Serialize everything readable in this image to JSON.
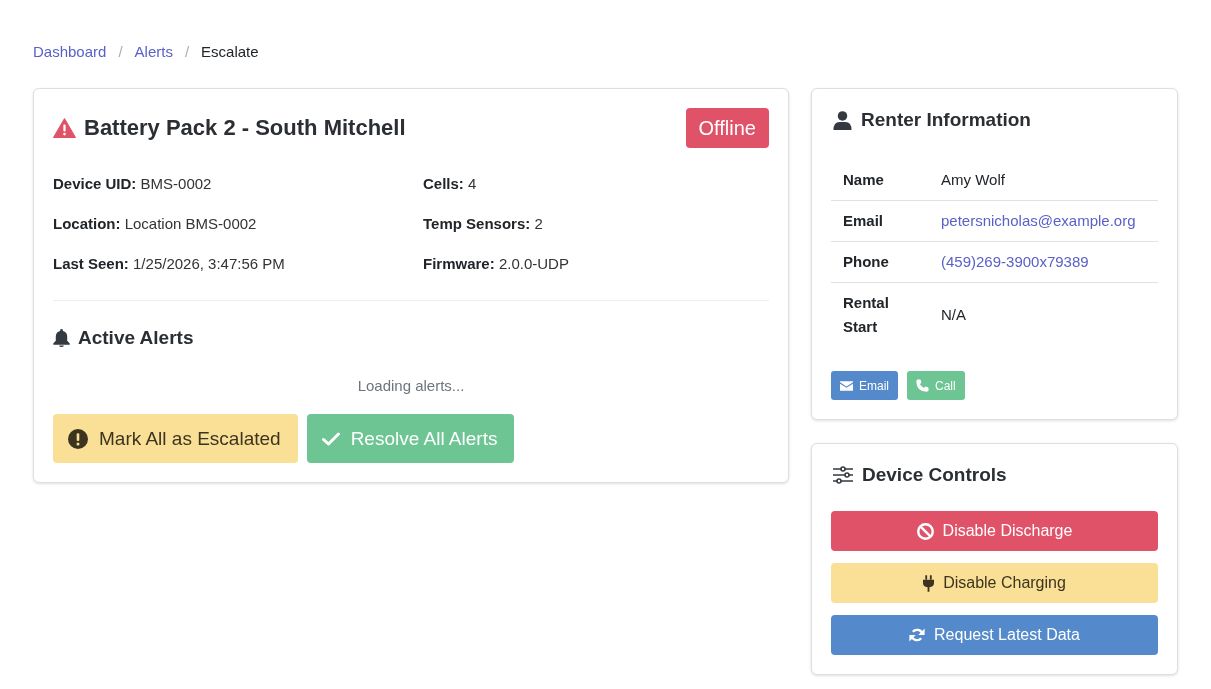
{
  "breadcrumb": {
    "separator": "/",
    "items": [
      {
        "label": "Dashboard",
        "kind": "link"
      },
      {
        "label": "Alerts",
        "kind": "link"
      },
      {
        "label": "Escalate",
        "kind": "current"
      }
    ]
  },
  "device_card": {
    "title": "Battery Pack 2 - South Mitchell",
    "status": "Offline",
    "field_columns": [
      {
        "fields": [
          {
            "label": "Device UID:",
            "value": "BMS-0002"
          },
          {
            "label": "Location:",
            "value": "Location BMS-0002"
          },
          {
            "label": "Last Seen:",
            "value": "1/25/2026, 3:47:56 PM"
          }
        ]
      },
      {
        "fields": [
          {
            "label": "Cells:",
            "value": "4"
          },
          {
            "label": "Temp Sensors:",
            "value": "2"
          },
          {
            "label": "Firmware:",
            "value": "2.0.0-UDP"
          }
        ]
      }
    ],
    "alerts": {
      "heading": "Active Alerts",
      "loading_text": "Loading alerts...",
      "buttons": [
        {
          "label": "Mark All as Escalated",
          "kind": "escalate"
        },
        {
          "label": "Resolve All Alerts",
          "kind": "resolve"
        }
      ]
    }
  },
  "renter_card": {
    "heading": "Renter Information",
    "rows": [
      {
        "label": "Name",
        "value": "Amy Wolf",
        "kind": "text"
      },
      {
        "label": "Email",
        "value": "petersnicholas@example.org",
        "kind": "email"
      },
      {
        "label": "Phone",
        "value": "(459)269-3900x79389",
        "kind": "phone"
      },
      {
        "label": "Rental Start",
        "value": "N/A",
        "kind": "text"
      }
    ],
    "buttons": [
      {
        "label": "Email",
        "kind": "email"
      },
      {
        "label": "Call",
        "kind": "call"
      }
    ]
  },
  "controls_card": {
    "heading": "Device Controls",
    "buttons": [
      {
        "label": "Disable Discharge",
        "kind": "discharge"
      },
      {
        "label": "Disable Charging",
        "kind": "charging"
      },
      {
        "label": "Request Latest Data",
        "kind": "refresh"
      }
    ]
  }
}
